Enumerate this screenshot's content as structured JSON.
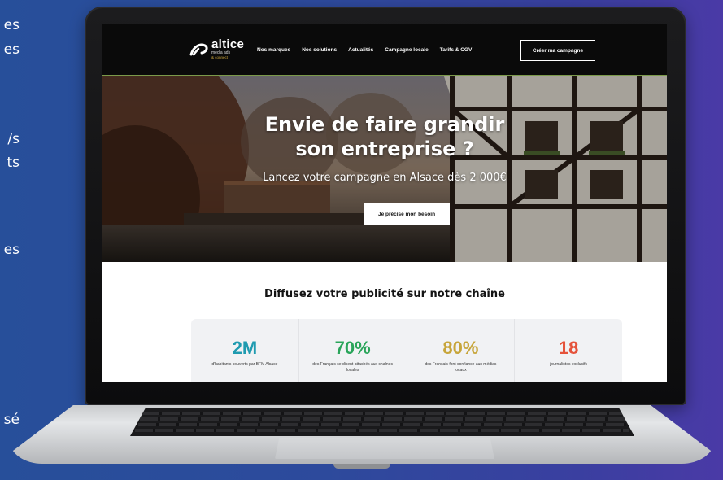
{
  "side_fragments": [
    "es",
    "es",
    "s/",
    "ts",
    "es",
    "sé"
  ],
  "site": {
    "logo": {
      "name": "altice",
      "sub1": "media ads",
      "sub2": "& connect"
    },
    "nav": [
      "Nos marques",
      "Nos solutions",
      "Actualités",
      "Campagne locale",
      "Tarifs & CGV"
    ],
    "header_cta": "Créer ma campagne",
    "hero": {
      "title_line1": "Envie de faire grandir",
      "title_line2": "son entreprise ?",
      "subtitle": "Lancez votre campagne en Alsace dès 2 000€",
      "button": "Je précise mon besoin"
    },
    "section_title": "Diffusez votre publicité sur notre chaîne",
    "stats": [
      {
        "value": "2M",
        "label": "d'habitants couverts par BFM Alsace",
        "color": "#1f9bb0"
      },
      {
        "value": "70%",
        "label": "des Français se disent attachés aux chaînes locales",
        "color": "#2aa55a"
      },
      {
        "value": "80%",
        "label": "des Français font confiance aux médias locaux",
        "color": "#c7a53a"
      },
      {
        "value": "18",
        "label": "journalistes exclusifs",
        "color": "#e5533b"
      }
    ]
  }
}
